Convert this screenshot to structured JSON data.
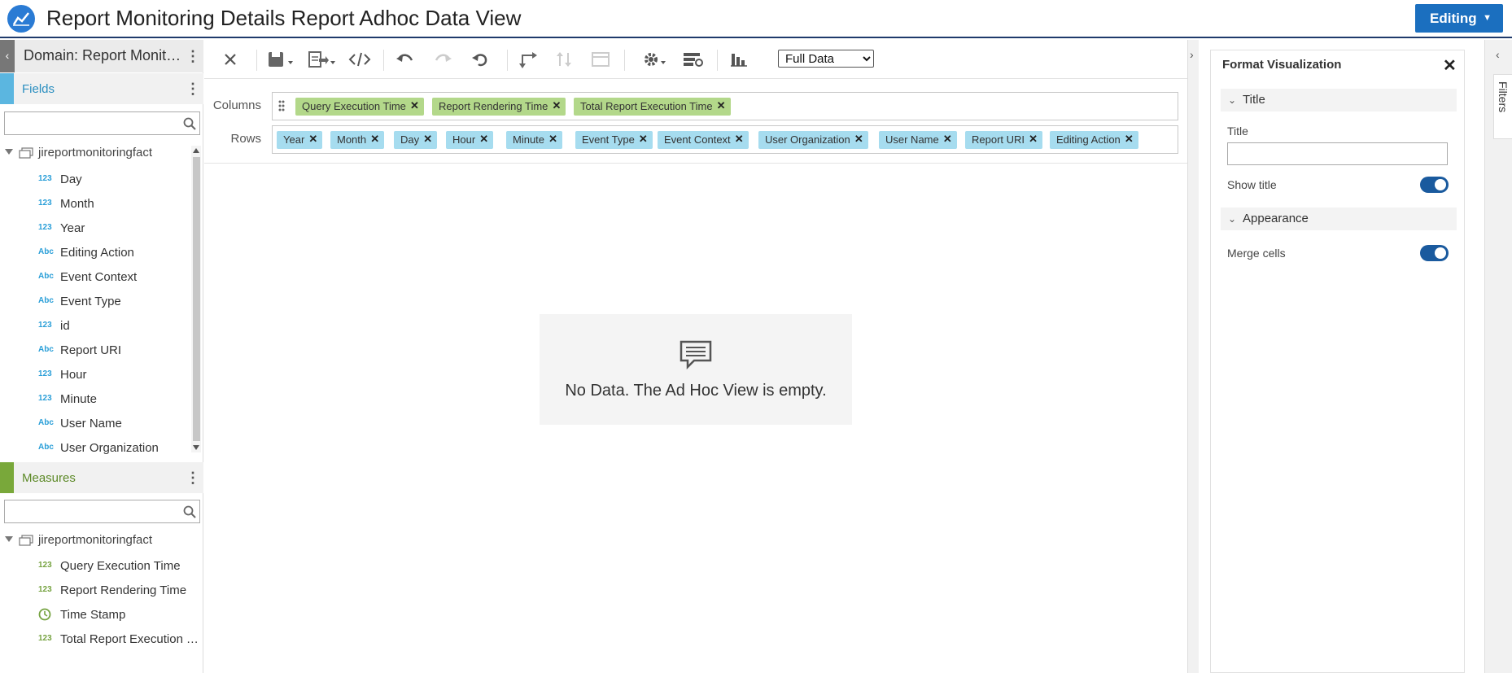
{
  "header": {
    "title": "Report Monitoring Details Report Adhoc Data View",
    "mode_label": "Editing"
  },
  "left_panel": {
    "domain_label": "Domain: Report Monitoring",
    "fields_section": {
      "label": "Fields",
      "search_value": "",
      "root_label": "jireportmonitoringfact",
      "items": [
        {
          "label": "Day",
          "type": "123"
        },
        {
          "label": "Month",
          "type": "123"
        },
        {
          "label": "Year",
          "type": "123"
        },
        {
          "label": "Editing Action",
          "type": "Abc"
        },
        {
          "label": "Event Context",
          "type": "Abc"
        },
        {
          "label": "Event Type",
          "type": "Abc"
        },
        {
          "label": "id",
          "type": "123"
        },
        {
          "label": "Report URI",
          "type": "Abc"
        },
        {
          "label": "Hour",
          "type": "123"
        },
        {
          "label": "Minute",
          "type": "123"
        },
        {
          "label": "User Name",
          "type": "Abc"
        },
        {
          "label": "User Organization",
          "type": "Abc"
        }
      ]
    },
    "measures_section": {
      "label": "Measures",
      "search_value": "",
      "root_label": "jireportmonitoringfact",
      "items": [
        {
          "label": "Query Execution Time",
          "type": "123"
        },
        {
          "label": "Report Rendering Time",
          "type": "123"
        },
        {
          "label": "Time Stamp",
          "type": "clock"
        },
        {
          "label": "Total Report Execution Time",
          "type": "123"
        }
      ]
    }
  },
  "toolbar": {
    "view_select": {
      "selected": "Full Data",
      "options": [
        "Full Data"
      ]
    }
  },
  "columns_zone": {
    "label": "Columns",
    "pills": [
      "Query Execution Time",
      "Report Rendering Time",
      "Total Report Execution Time"
    ]
  },
  "rows_zone": {
    "label": "Rows",
    "pills": [
      "Year",
      "Month",
      "Day",
      "Hour",
      "Minute",
      "Event Type",
      "Event Context",
      "User Organization",
      "User Name",
      "Report URI",
      "Editing Action"
    ]
  },
  "canvas": {
    "empty_message": "No Data. The Ad Hoc View is empty."
  },
  "format_panel": {
    "title": "Format Visualization",
    "title_section": {
      "heading": "Title",
      "title_label": "Title",
      "title_value": "",
      "show_title_label": "Show title",
      "show_title_on": true
    },
    "appearance_section": {
      "heading": "Appearance",
      "merge_cells_label": "Merge cells",
      "merge_cells_on": true
    }
  },
  "filters_tab": {
    "label": "Filters"
  },
  "colors": {
    "brand_blue": "#1b6fbf",
    "fields_stripe": "#5bb6e0",
    "measures_stripe": "#79a83a",
    "column_pill": "#b3d88a",
    "row_pill": "#a6dcef",
    "toggle_on": "#1a5a9e"
  }
}
